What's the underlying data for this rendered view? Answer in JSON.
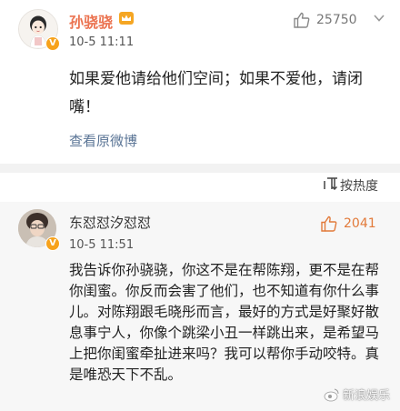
{
  "post": {
    "author": "孙骁骁",
    "time": "10-5 11:11",
    "like_count": "25750",
    "content": "如果爱他请给他们空间；如果不爱他，请闭嘴！",
    "view_original": "查看原微博"
  },
  "sort": {
    "label": "按热度",
    "icon": "sort-icon"
  },
  "comment": {
    "author": "东怼怼汐怼怼",
    "time": "10-5 11:51",
    "like_count": "2041",
    "content": "我告诉你孙骁骁，你这不是在帮陈翔，更不是在帮你闺蜜。你反而会害了他们，也不知道有你什么事儿。对陈翔跟毛晓彤而言，最好的方式是好聚好散息事宁人，你像个跳梁小丑一样跳出来，是希望马上把你闺蜜牵扯进来吗？我可以帮你手动咬特。真是唯恐天下不乱。"
  },
  "watermark": {
    "text": "新浪娱乐"
  },
  "colors": {
    "accent_name": "#eb7350",
    "link": "#5b7596",
    "badge": "#f7a21b",
    "like_highlight": "#e27a3a"
  }
}
